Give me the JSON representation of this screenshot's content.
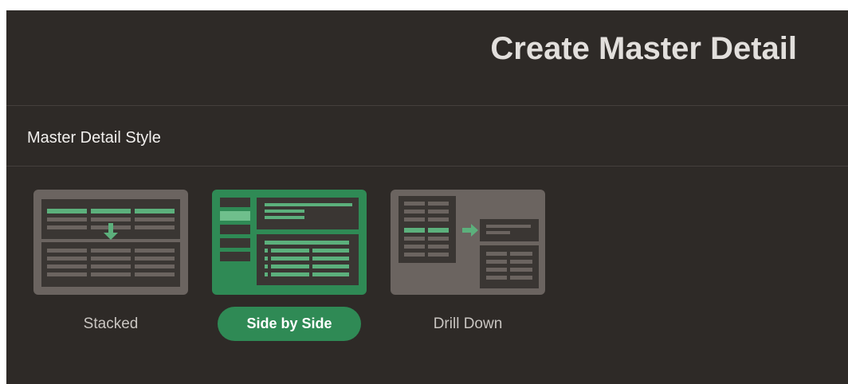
{
  "dialog": {
    "title": "Create Master Detail"
  },
  "section": {
    "title": "Master Detail Style"
  },
  "styles": [
    {
      "label": "Stacked",
      "selected": false,
      "icon": "stacked-layout-icon"
    },
    {
      "label": "Side by Side",
      "selected": true,
      "icon": "side-by-side-layout-icon"
    },
    {
      "label": "Drill Down",
      "selected": false,
      "icon": "drill-down-layout-icon"
    }
  ],
  "colors": {
    "dialog_background": "#2e2a27",
    "tile_background": "#6b6460",
    "selected_tile": "#2f8a55",
    "accent_green": "#5cb07c",
    "tile_dark": "#3a3633",
    "selected_pill": "#2f8a55"
  }
}
